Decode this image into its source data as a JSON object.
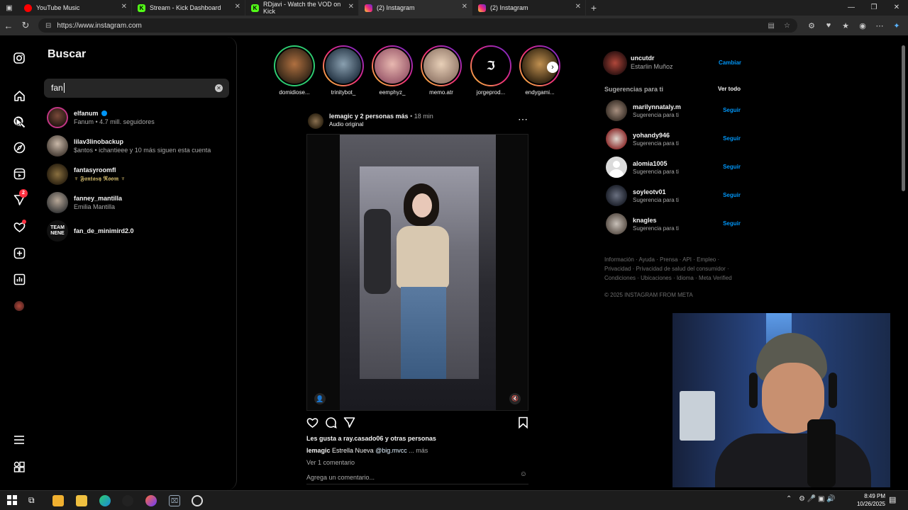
{
  "browser": {
    "tabs": [
      {
        "title": "YouTube Music",
        "favicon": "youtube-music-icon",
        "color": "#ff0000",
        "active": false
      },
      {
        "title": "Stream - Kick Dashboard",
        "favicon": "kick-icon",
        "color": "#53fc18",
        "active": false
      },
      {
        "title": "RDjavi - Watch the VOD on Kick",
        "favicon": "kick-icon",
        "color": "#53fc18",
        "active": false
      },
      {
        "title": "(2) Instagram",
        "favicon": "instagram-icon",
        "color": "#e1306c",
        "active": true
      },
      {
        "title": "(2) Instagram",
        "favicon": "instagram-icon",
        "color": "#e1306c",
        "active": false
      }
    ],
    "url": "https://www.instagram.com",
    "new_tab": "+",
    "close_glyph": "✕"
  },
  "sidebar": {
    "notification_count": "2"
  },
  "search": {
    "title": "Buscar",
    "query": "fan",
    "results": [
      {
        "username": "elfanum",
        "verified": true,
        "subtitle": "Fanum • 4.7 mill. seguidores"
      },
      {
        "username": "lilav3linobackup",
        "verified": false,
        "subtitle": "$antos • ichantieee y 10 más siguen esta cuenta"
      },
      {
        "username": "fantasyroomfl",
        "verified": false,
        "subtitle": "♆ 𝕱𝖆𝖓𝖙𝖆𝖘𝖞 𝕽𝖔𝖔𝖒 ♆"
      },
      {
        "username": "fanney_mantilla",
        "verified": false,
        "subtitle": "Emilia Mantilla"
      },
      {
        "username": "fan_de_minimird2.0",
        "verified": false,
        "subtitle": ""
      }
    ]
  },
  "stories": [
    {
      "name": "domidiose..."
    },
    {
      "name": "trinitybot_"
    },
    {
      "name": "eemphyz_"
    },
    {
      "name": "memo.atr"
    },
    {
      "name": "jorgeprod..."
    },
    {
      "name": "endygami..."
    }
  ],
  "post": {
    "author": "lemagic y 2 personas más",
    "time": "18 min",
    "audio": "Audio original",
    "likes": "Les gusta a ray.casado06 y otras personas",
    "caption_user": "lemagic",
    "caption_text": "Estrella Nueva",
    "caption_mention": "@big.mvcc",
    "caption_more": "... más",
    "comments": "Ver 1 comentario",
    "comment_placeholder": "Agrega un comentario..."
  },
  "account": {
    "username": "uncutdr",
    "name": "Estarlin Muñoz",
    "switch": "Cambiar"
  },
  "suggestions": {
    "title": "Sugerencias para ti",
    "see_all": "Ver todo",
    "items": [
      {
        "username": "marilynnataly.m",
        "sub": "Sugerencia para ti",
        "action": "Seguir"
      },
      {
        "username": "yohandy946",
        "sub": "Sugerencia para ti",
        "action": "Seguir"
      },
      {
        "username": "alomia1005",
        "sub": "Sugerencia para ti",
        "action": "Seguir"
      },
      {
        "username": "soyleotv01",
        "sub": "Sugerencia para ti",
        "action": "Seguir"
      },
      {
        "username": "knagles",
        "sub": "Sugerencia para ti",
        "action": "Seguir"
      }
    ]
  },
  "footer": {
    "line1": "Información · Ayuda · Prensa · API · Empleo ·",
    "line2": "Privacidad · Privacidad de salud del consumidor ·",
    "line3": "Condiciones · Ubicaciones · Idioma · Meta Verified",
    "copyright": "© 2025 INSTAGRAM FROM META"
  },
  "taskbar": {
    "time": "8:49 PM",
    "date": "10/26/2025"
  },
  "colors": {
    "accent": "#0095f6",
    "background": "#000000",
    "muted": "#a8a8a8"
  }
}
